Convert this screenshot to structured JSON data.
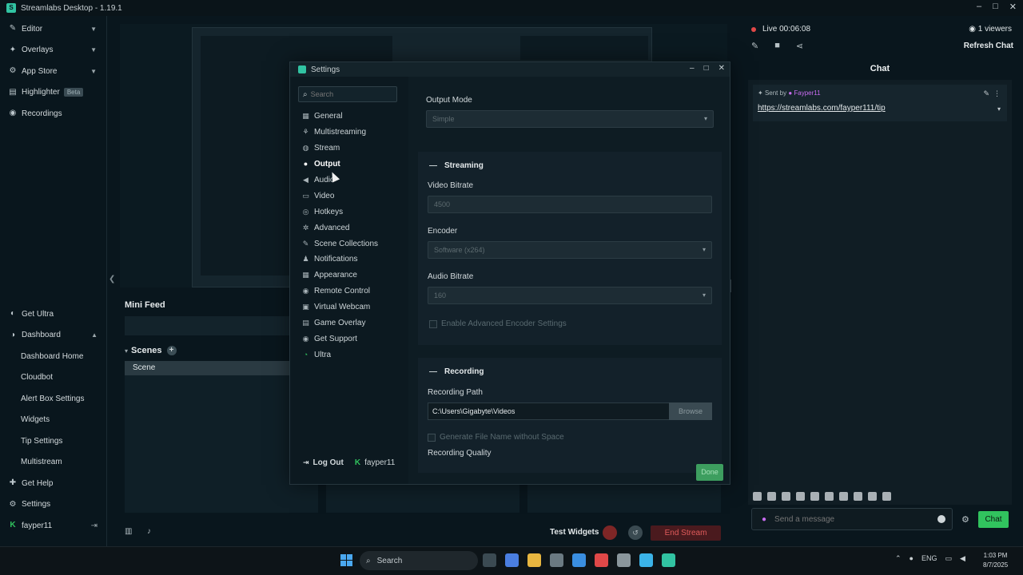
{
  "window": {
    "title": "Streamlabs Desktop - 1.19.1"
  },
  "sidebar": {
    "items": [
      {
        "label": "Editor",
        "icon": "pencil-icon",
        "chevron": true
      },
      {
        "label": "Overlays",
        "icon": "overlays-icon",
        "chevron": true
      },
      {
        "label": "App Store",
        "icon": "store-icon",
        "chevron": true
      },
      {
        "label": "Highlighter",
        "icon": "highlighter-icon",
        "badge": "Beta"
      },
      {
        "label": "Recordings",
        "icon": "recordings-icon"
      }
    ],
    "bottom": {
      "get_ultra": "Get Ultra",
      "dashboard": "Dashboard",
      "dashboard_items": [
        "Dashboard Home",
        "Cloudbot",
        "Alert Box Settings",
        "Widgets",
        "Tip Settings",
        "Multistream"
      ],
      "get_help": "Get Help",
      "settings": "Settings",
      "user": "fayper11"
    }
  },
  "editor": {
    "mini_feed": "Mini Feed",
    "scenes_title": "Scenes",
    "scene_item": "Scene",
    "test_widgets": "Test Widgets",
    "end_stream": "End Stream"
  },
  "right_panel": {
    "live_status": "Live 00:06:08",
    "viewers": "1 viewers",
    "refresh_chat": "Refresh Chat",
    "chat_title": "Chat",
    "pinned": {
      "sent_by_label": "Sent by",
      "username": "Fayper11",
      "link": "https://streamlabs.com/fayper111/tip"
    },
    "message_placeholder": "Send a message",
    "send_label": "Chat"
  },
  "settings": {
    "title": "Settings",
    "search_placeholder": "Search",
    "nav": [
      {
        "label": "General",
        "icon": "grid-icon"
      },
      {
        "label": "Multistreaming",
        "icon": "multistream-icon"
      },
      {
        "label": "Stream",
        "icon": "globe-icon"
      },
      {
        "label": "Output",
        "icon": "database-icon",
        "active": true
      },
      {
        "label": "Audio",
        "icon": "speaker-icon"
      },
      {
        "label": "Video",
        "icon": "video-icon"
      },
      {
        "label": "Hotkeys",
        "icon": "keyboard-icon"
      },
      {
        "label": "Advanced",
        "icon": "cogs-icon"
      },
      {
        "label": "Scene Collections",
        "icon": "collections-icon"
      },
      {
        "label": "Notifications",
        "icon": "bell-icon"
      },
      {
        "label": "Appearance",
        "icon": "appearance-icon"
      },
      {
        "label": "Remote Control",
        "icon": "remote-icon"
      },
      {
        "label": "Virtual Webcam",
        "icon": "webcam-icon"
      },
      {
        "label": "Game Overlay",
        "icon": "overlay-icon"
      },
      {
        "label": "Get Support",
        "icon": "support-icon"
      },
      {
        "label": "Ultra",
        "icon": "ultra-icon"
      }
    ],
    "logout": "Log Out",
    "username": "fayper11",
    "output_mode_label": "Output Mode",
    "output_mode_value": "Simple",
    "streaming_section": "Streaming",
    "video_bitrate_label": "Video Bitrate",
    "video_bitrate_value": "4500",
    "encoder_label": "Encoder",
    "encoder_value": "Software (x264)",
    "audio_bitrate_label": "Audio Bitrate",
    "audio_bitrate_value": "160",
    "advanced_encoder_label": "Enable Advanced Encoder Settings",
    "recording_section": "Recording",
    "recording_path_label": "Recording Path",
    "recording_path_value": "C:\\Users\\Gigabyte\\Videos",
    "browse_label": "Browse",
    "filename_nospace_label": "Generate File Name without Space",
    "recording_quality_label": "Recording Quality",
    "done_label": "Done"
  },
  "taskbar": {
    "search": "Search",
    "lang": "ENG",
    "time": "1:03 PM",
    "date": "8/7/2025"
  },
  "colors": {
    "accent_green": "#31c35e",
    "live_red": "#e14848",
    "bg_dark": "#09161d"
  }
}
